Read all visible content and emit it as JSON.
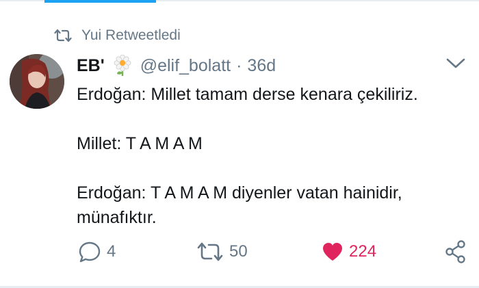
{
  "context": {
    "icon": "retweet-icon",
    "text": "Yui Retweetledi"
  },
  "tweet": {
    "author": {
      "display_name": "EB'",
      "emoji_icon": "flower-icon",
      "handle": "@elif_bolatt",
      "separator": "·",
      "time": "36d"
    },
    "lines": [
      "Erdoğan: Millet tamam derse kenara çekiliriz.",
      "Millet: T A M A M",
      "Erdoğan: T A M A M diyenler vatan hainidir,",
      "münafıktır."
    ]
  },
  "actions": {
    "reply_count": "4",
    "retweet_count": "50",
    "like_count": "224"
  },
  "colors": {
    "accent": "#1da1f2",
    "like": "#e0245e",
    "muted": "#657786",
    "text": "#14171a"
  }
}
